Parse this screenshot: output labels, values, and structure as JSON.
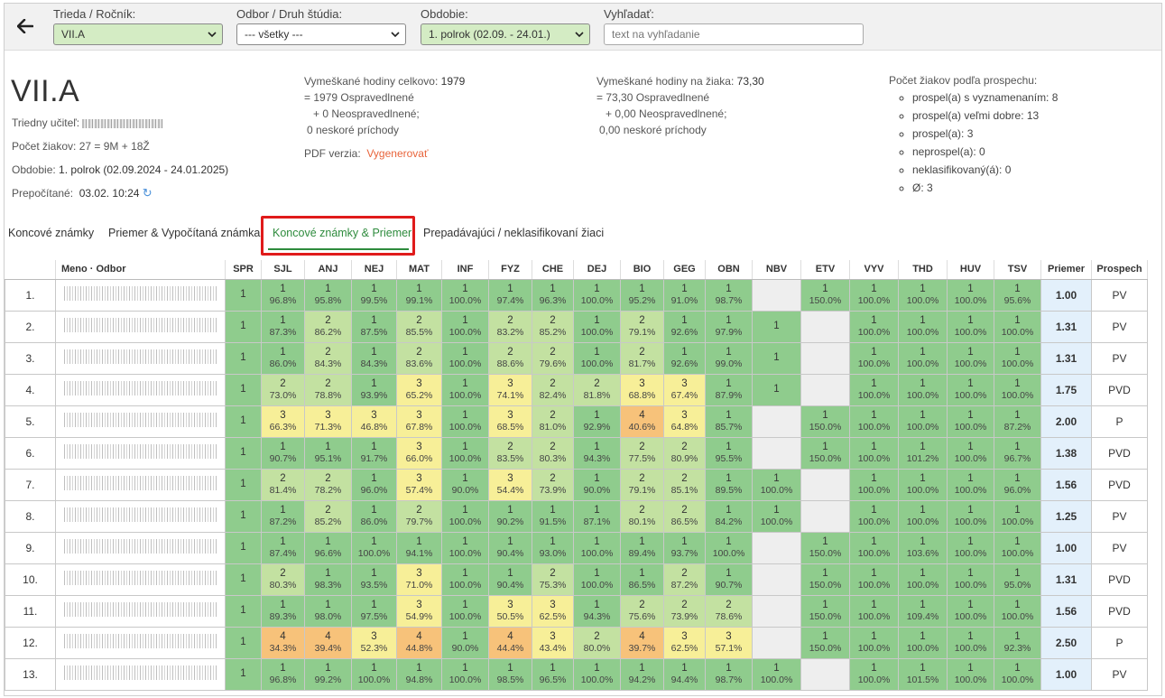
{
  "filters": {
    "class": {
      "label": "Trieda / Ročník:",
      "value": "VII.A"
    },
    "field": {
      "label": "Odbor / Druh štúdia:",
      "value": "--- všetky ---"
    },
    "period": {
      "label": "Obdobie:",
      "value": "1. polrok (02.09. - 24.01.)"
    },
    "search": {
      "label": "Vyhľadať:",
      "placeholder": "text na vyhľadanie"
    }
  },
  "class_info": {
    "title": "VII.A",
    "teacher_label": "Triedny učiteľ:",
    "student_count": "Počet žiakov: 27 = 9M + 18Ž",
    "period_label": "Obdobie:",
    "period_value": "1. polrok (02.09.2024 - 24.01.2025)",
    "recalc_label": "Prepočítané:",
    "recalc_value": "03.02. 10:24"
  },
  "absences_total": {
    "line1_label": "Vymeškané hodiny celkovo:",
    "line1_value": "1979",
    "line2": "= 1979 Ospravedlnené",
    "line3": "+ 0 Neospravedlnené;",
    "line4": "0 neskoré príchody",
    "pdf_label": "PDF verzia:",
    "pdf_link": "Vygenerovať"
  },
  "absences_per_student": {
    "line1_label": "Vymeškané hodiny na žiaka:",
    "line1_value": "73,30",
    "line2": "= 73,30 Ospravedlnené",
    "line3": "+ 0,00 Neospravedlnené;",
    "line4": "0,00 neskoré príchody"
  },
  "results": {
    "heading": "Počet žiakov podľa prospechu:",
    "items": [
      "prospel(a) s vyznamenaním: 8",
      "prospel(a) veľmi dobre: 13",
      "prospel(a): 3",
      "neprospel(a): 0",
      "neklasifikovaný(á): 0",
      "Ø: 3"
    ]
  },
  "tabs": [
    "Koncové známky",
    "Priemer & Vypočítaná známka",
    "Koncové známky & Priemer",
    "Prepadávajúci / neklasifikovaní žiaci"
  ],
  "active_tab": 2,
  "table": {
    "name_header": "Meno · Odbor",
    "subjects": [
      "SPR",
      "SJL",
      "ANJ",
      "NEJ",
      "MAT",
      "INF",
      "FYZ",
      "CHE",
      "DEJ",
      "BIO",
      "GEG",
      "OBN",
      "NBV",
      "ETV",
      "VYV",
      "THD",
      "HUV",
      "TSV"
    ],
    "avg_header": "Priemer",
    "result_header": "Prospech",
    "rows": [
      {
        "n": "1.",
        "cells": [
          [
            "1",
            ""
          ],
          [
            "1",
            "96.8%"
          ],
          [
            "1",
            "95.8%"
          ],
          [
            "1",
            "99.5%"
          ],
          [
            "1",
            "99.1%"
          ],
          [
            "1",
            "100.0%"
          ],
          [
            "1",
            "97.4%"
          ],
          [
            "1",
            "96.3%"
          ],
          [
            "1",
            "100.0%"
          ],
          [
            "1",
            "95.2%"
          ],
          [
            "1",
            "91.0%"
          ],
          [
            "1",
            "98.7%"
          ],
          null,
          [
            "1",
            "150.0%"
          ],
          [
            "1",
            "100.0%"
          ],
          [
            "1",
            "100.0%"
          ],
          [
            "1",
            "100.0%"
          ],
          [
            "1",
            "95.6%"
          ]
        ],
        "avg": "1.00",
        "res": "PV"
      },
      {
        "n": "2.",
        "cells": [
          [
            "1",
            ""
          ],
          [
            "1",
            "87.3%"
          ],
          [
            "2",
            "86.2%"
          ],
          [
            "1",
            "87.5%"
          ],
          [
            "2",
            "85.5%"
          ],
          [
            "1",
            "100.0%"
          ],
          [
            "2",
            "83.2%"
          ],
          [
            "2",
            "85.2%"
          ],
          [
            "1",
            "100.0%"
          ],
          [
            "2",
            "79.1%"
          ],
          [
            "1",
            "92.6%"
          ],
          [
            "1",
            "97.9%"
          ],
          [
            "1",
            ""
          ],
          null,
          [
            "1",
            "100.0%"
          ],
          [
            "1",
            "100.0%"
          ],
          [
            "1",
            "100.0%"
          ],
          [
            "1",
            "100.0%"
          ]
        ],
        "avg": "1.31",
        "res": "PV"
      },
      {
        "n": "3.",
        "cells": [
          [
            "1",
            ""
          ],
          [
            "1",
            "86.0%"
          ],
          [
            "2",
            "84.3%"
          ],
          [
            "1",
            "84.3%"
          ],
          [
            "2",
            "83.6%"
          ],
          [
            "1",
            "100.0%"
          ],
          [
            "2",
            "88.6%"
          ],
          [
            "2",
            "79.6%"
          ],
          [
            "1",
            "100.0%"
          ],
          [
            "2",
            "81.7%"
          ],
          [
            "1",
            "92.6%"
          ],
          [
            "1",
            "99.0%"
          ],
          [
            "1",
            ""
          ],
          null,
          [
            "1",
            "100.0%"
          ],
          [
            "1",
            "100.0%"
          ],
          [
            "1",
            "100.0%"
          ],
          [
            "1",
            "100.0%"
          ]
        ],
        "avg": "1.31",
        "res": "PV"
      },
      {
        "n": "4.",
        "cells": [
          [
            "1",
            ""
          ],
          [
            "2",
            "73.0%"
          ],
          [
            "2",
            "78.8%"
          ],
          [
            "1",
            "93.9%"
          ],
          [
            "3",
            "65.2%"
          ],
          [
            "1",
            "100.0%"
          ],
          [
            "3",
            "74.1%"
          ],
          [
            "2",
            "82.4%"
          ],
          [
            "2",
            "81.8%"
          ],
          [
            "3",
            "68.8%"
          ],
          [
            "3",
            "67.4%"
          ],
          [
            "1",
            "87.9%"
          ],
          [
            "1",
            ""
          ],
          null,
          [
            "1",
            "100.0%"
          ],
          [
            "1",
            "100.0%"
          ],
          [
            "1",
            "100.0%"
          ],
          [
            "1",
            "100.0%"
          ]
        ],
        "avg": "1.75",
        "res": "PVD"
      },
      {
        "n": "5.",
        "cells": [
          [
            "1",
            ""
          ],
          [
            "3",
            "66.3%"
          ],
          [
            "3",
            "71.3%"
          ],
          [
            "3",
            "46.8%"
          ],
          [
            "3",
            "67.8%"
          ],
          [
            "1",
            "100.0%"
          ],
          [
            "3",
            "68.5%"
          ],
          [
            "2",
            "81.0%"
          ],
          [
            "1",
            "92.9%"
          ],
          [
            "4",
            "40.6%"
          ],
          [
            "3",
            "64.8%"
          ],
          [
            "1",
            "85.7%"
          ],
          null,
          [
            "1",
            "150.0%"
          ],
          [
            "1",
            "100.0%"
          ],
          [
            "1",
            "100.0%"
          ],
          [
            "1",
            "100.0%"
          ],
          [
            "1",
            "87.2%"
          ]
        ],
        "avg": "2.00",
        "res": "P"
      },
      {
        "n": "6.",
        "cells": [
          [
            "1",
            ""
          ],
          [
            "1",
            "90.7%"
          ],
          [
            "1",
            "95.1%"
          ],
          [
            "1",
            "91.7%"
          ],
          [
            "3",
            "66.0%"
          ],
          [
            "1",
            "100.0%"
          ],
          [
            "2",
            "83.5%"
          ],
          [
            "2",
            "80.3%"
          ],
          [
            "1",
            "94.3%"
          ],
          [
            "2",
            "77.5%"
          ],
          [
            "2",
            "80.9%"
          ],
          [
            "1",
            "95.5%"
          ],
          null,
          [
            "1",
            "150.0%"
          ],
          [
            "1",
            "100.0%"
          ],
          [
            "1",
            "101.2%"
          ],
          [
            "1",
            "100.0%"
          ],
          [
            "1",
            "96.7%"
          ]
        ],
        "avg": "1.38",
        "res": "PVD"
      },
      {
        "n": "7.",
        "cells": [
          [
            "1",
            ""
          ],
          [
            "2",
            "81.4%"
          ],
          [
            "2",
            "78.2%"
          ],
          [
            "1",
            "96.0%"
          ],
          [
            "3",
            "57.4%"
          ],
          [
            "1",
            "90.0%"
          ],
          [
            "3",
            "54.4%"
          ],
          [
            "2",
            "73.9%"
          ],
          [
            "1",
            "90.0%"
          ],
          [
            "2",
            "79.1%"
          ],
          [
            "2",
            "85.1%"
          ],
          [
            "1",
            "89.5%"
          ],
          [
            "1",
            "100.0%"
          ],
          null,
          [
            "1",
            "100.0%"
          ],
          [
            "1",
            "100.0%"
          ],
          [
            "1",
            "100.0%"
          ],
          [
            "1",
            "96.0%"
          ]
        ],
        "avg": "1.56",
        "res": "PVD"
      },
      {
        "n": "8.",
        "cells": [
          [
            "1",
            ""
          ],
          [
            "1",
            "87.2%"
          ],
          [
            "2",
            "85.2%"
          ],
          [
            "1",
            "86.0%"
          ],
          [
            "2",
            "79.7%"
          ],
          [
            "1",
            "100.0%"
          ],
          [
            "1",
            "90.2%"
          ],
          [
            "1",
            "91.5%"
          ],
          [
            "1",
            "87.1%"
          ],
          [
            "2",
            "80.1%"
          ],
          [
            "2",
            "86.5%"
          ],
          [
            "1",
            "84.2%"
          ],
          [
            "1",
            "100.0%"
          ],
          null,
          [
            "1",
            "100.0%"
          ],
          [
            "1",
            "100.0%"
          ],
          [
            "1",
            "100.0%"
          ],
          [
            "1",
            "100.0%"
          ]
        ],
        "avg": "1.25",
        "res": "PV"
      },
      {
        "n": "9.",
        "cells": [
          [
            "1",
            ""
          ],
          [
            "1",
            "87.4%"
          ],
          [
            "1",
            "96.6%"
          ],
          [
            "1",
            "100.0%"
          ],
          [
            "1",
            "94.1%"
          ],
          [
            "1",
            "100.0%"
          ],
          [
            "1",
            "90.4%"
          ],
          [
            "1",
            "93.0%"
          ],
          [
            "1",
            "100.0%"
          ],
          [
            "1",
            "89.4%"
          ],
          [
            "1",
            "93.7%"
          ],
          [
            "1",
            "100.0%"
          ],
          null,
          [
            "1",
            "150.0%"
          ],
          [
            "1",
            "100.0%"
          ],
          [
            "1",
            "103.6%"
          ],
          [
            "1",
            "100.0%"
          ],
          [
            "1",
            "100.0%"
          ]
        ],
        "avg": "1.00",
        "res": "PV"
      },
      {
        "n": "10.",
        "cells": [
          [
            "1",
            ""
          ],
          [
            "2",
            "80.3%"
          ],
          [
            "1",
            "98.3%"
          ],
          [
            "1",
            "93.5%"
          ],
          [
            "3",
            "71.0%"
          ],
          [
            "1",
            "100.0%"
          ],
          [
            "1",
            "90.4%"
          ],
          [
            "2",
            "75.3%"
          ],
          [
            "1",
            "100.0%"
          ],
          [
            "1",
            "86.5%"
          ],
          [
            "2",
            "87.2%"
          ],
          [
            "1",
            "90.7%"
          ],
          null,
          [
            "1",
            "150.0%"
          ],
          [
            "1",
            "100.0%"
          ],
          [
            "1",
            "100.0%"
          ],
          [
            "1",
            "100.0%"
          ],
          [
            "1",
            "95.0%"
          ]
        ],
        "avg": "1.31",
        "res": "PVD"
      },
      {
        "n": "11.",
        "cells": [
          [
            "1",
            ""
          ],
          [
            "1",
            "89.3%"
          ],
          [
            "1",
            "98.0%"
          ],
          [
            "1",
            "97.5%"
          ],
          [
            "3",
            "54.9%"
          ],
          [
            "1",
            "100.0%"
          ],
          [
            "3",
            "50.5%"
          ],
          [
            "3",
            "62.5%"
          ],
          [
            "1",
            "94.3%"
          ],
          [
            "2",
            "75.6%"
          ],
          [
            "2",
            "73.9%"
          ],
          [
            "2",
            "78.6%"
          ],
          null,
          [
            "1",
            "150.0%"
          ],
          [
            "1",
            "100.0%"
          ],
          [
            "1",
            "109.4%"
          ],
          [
            "1",
            "100.0%"
          ],
          [
            "1",
            "100.0%"
          ]
        ],
        "avg": "1.56",
        "res": "PVD"
      },
      {
        "n": "12.",
        "cells": [
          [
            "1",
            ""
          ],
          [
            "4",
            "34.3%"
          ],
          [
            "4",
            "39.4%"
          ],
          [
            "3",
            "52.3%"
          ],
          [
            "4",
            "44.8%"
          ],
          [
            "1",
            "90.0%"
          ],
          [
            "4",
            "44.4%"
          ],
          [
            "3",
            "43.4%"
          ],
          [
            "2",
            "80.0%"
          ],
          [
            "4",
            "39.7%"
          ],
          [
            "3",
            "62.5%"
          ],
          [
            "3",
            "57.1%"
          ],
          null,
          [
            "1",
            "150.0%"
          ],
          [
            "1",
            "100.0%"
          ],
          [
            "1",
            "100.0%"
          ],
          [
            "1",
            "100.0%"
          ],
          [
            "1",
            "92.3%"
          ]
        ],
        "avg": "2.50",
        "res": "P"
      },
      {
        "n": "13.",
        "cells": [
          [
            "1",
            ""
          ],
          [
            "1",
            "96.8%"
          ],
          [
            "1",
            "99.2%"
          ],
          [
            "1",
            "100.0%"
          ],
          [
            "1",
            "94.8%"
          ],
          [
            "1",
            "100.0%"
          ],
          [
            "1",
            "98.5%"
          ],
          [
            "1",
            "96.5%"
          ],
          [
            "1",
            "100.0%"
          ],
          [
            "1",
            "94.2%"
          ],
          [
            "1",
            "94.4%"
          ],
          [
            "1",
            "98.7%"
          ],
          [
            "1",
            "100.0%"
          ],
          null,
          [
            "1",
            "100.0%"
          ],
          [
            "1",
            "101.5%"
          ],
          [
            "1",
            "100.0%"
          ],
          [
            "1",
            "100.0%"
          ]
        ],
        "avg": "1.00",
        "res": "PV"
      }
    ]
  },
  "colors": {
    "grade_1": "#8fcc8d",
    "grade_2": "#c3e1a1",
    "grade_3": "#f7ef98",
    "grade_4": "#f7c27a",
    "empty": "#eeeeee",
    "average_bg": "#e3f0fb",
    "active_tab": "#2e8b3d",
    "highlight_box": "#e01b1b",
    "link": "#e8643b"
  }
}
